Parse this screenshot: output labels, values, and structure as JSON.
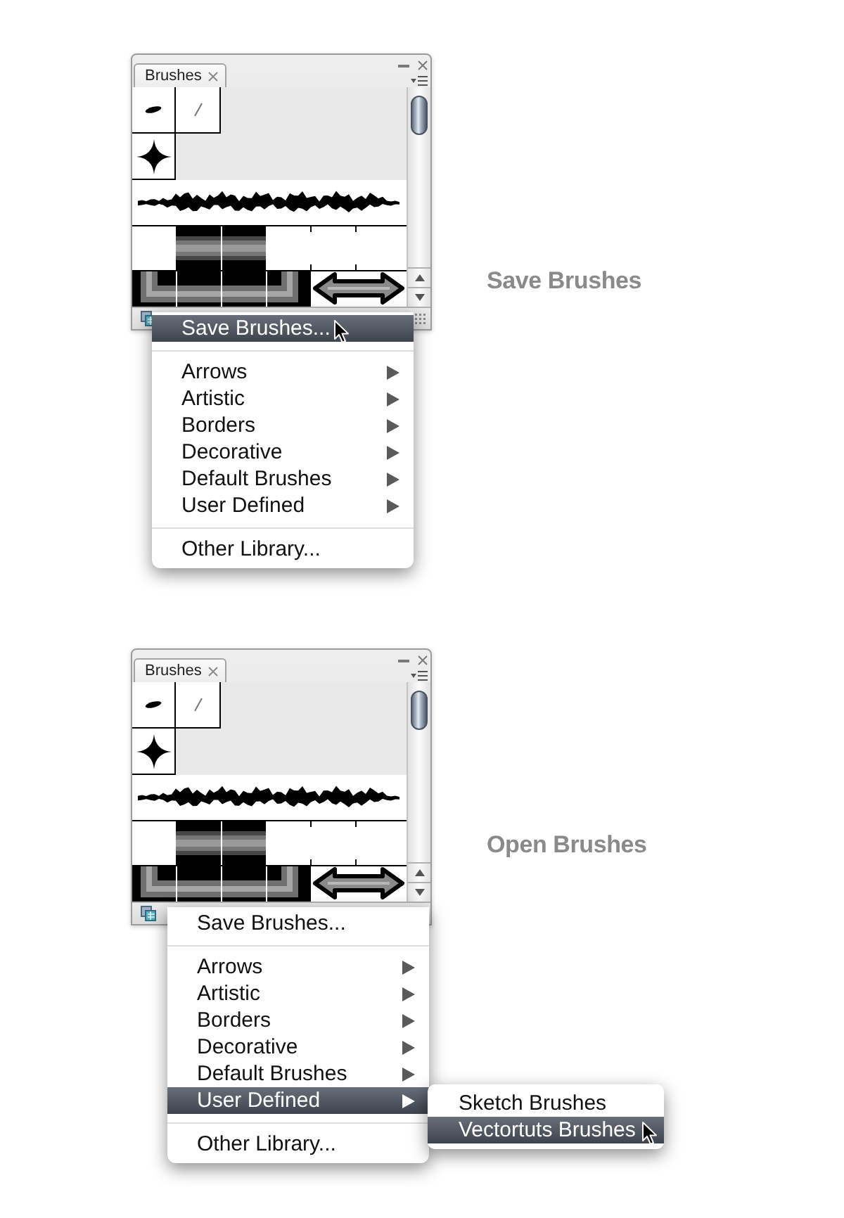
{
  "sections": [
    {
      "panel": {
        "tab": "Brushes"
      },
      "menu": [
        {
          "kind": "command",
          "label": "Save Brushes...",
          "selected": true
        },
        {
          "kind": "separator"
        },
        {
          "kind": "submenu",
          "label": "Arrows",
          "selected": false
        },
        {
          "kind": "submenu",
          "label": "Artistic",
          "selected": false
        },
        {
          "kind": "submenu",
          "label": "Borders",
          "selected": false
        },
        {
          "kind": "submenu",
          "label": "Decorative",
          "selected": false
        },
        {
          "kind": "submenu",
          "label": "Default Brushes",
          "selected": false
        },
        {
          "kind": "submenu",
          "label": "User Defined",
          "selected": false
        },
        {
          "kind": "separator"
        },
        {
          "kind": "command",
          "label": "Other Library...",
          "selected": false
        }
      ],
      "caption": "Save Brushes"
    },
    {
      "panel": {
        "tab": "Brushes"
      },
      "menu": [
        {
          "kind": "command",
          "label": "Save Brushes...",
          "selected": false
        },
        {
          "kind": "separator"
        },
        {
          "kind": "submenu",
          "label": "Arrows",
          "selected": false
        },
        {
          "kind": "submenu",
          "label": "Artistic",
          "selected": false
        },
        {
          "kind": "submenu",
          "label": "Borders",
          "selected": false
        },
        {
          "kind": "submenu",
          "label": "Decorative",
          "selected": false
        },
        {
          "kind": "submenu",
          "label": "Default Brushes",
          "selected": false
        },
        {
          "kind": "submenu",
          "label": "User Defined",
          "selected": true,
          "children": [
            {
              "label": "Sketch Brushes",
              "selected": false
            },
            {
              "label": "Vectortuts Brushes",
              "selected": true
            }
          ]
        },
        {
          "kind": "separator"
        },
        {
          "kind": "command",
          "label": "Other Library...",
          "selected": false
        }
      ],
      "caption": "Open Brushes"
    }
  ]
}
